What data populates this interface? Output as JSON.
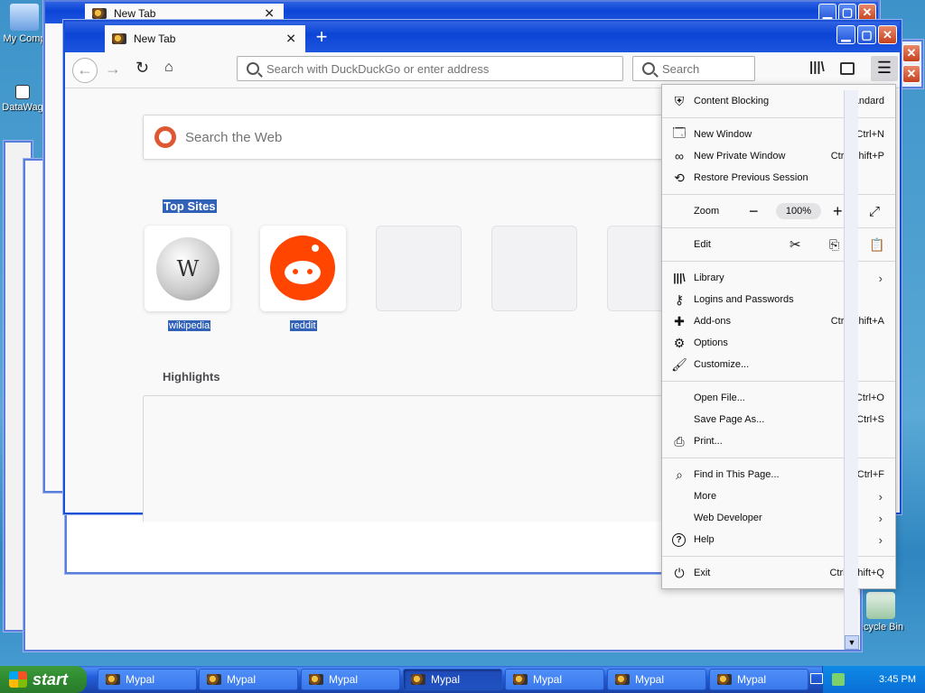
{
  "desktop": {
    "icons": [
      {
        "label": "My Comp"
      },
      {
        "label": "DataWag"
      },
      {
        "label": "ecycle Bin"
      }
    ]
  },
  "browser": {
    "back_window_tab": "New Tab",
    "tab_title": "New Tab",
    "new_tab_symbol": "+",
    "url_placeholder": "Search with DuckDuckGo or enter address",
    "search_placeholder": "Search",
    "page_search_placeholder": "Search the Web",
    "top_sites_heading": "Top Sites",
    "top_sites": [
      {
        "label": "wikipedia"
      },
      {
        "label": "reddit"
      }
    ],
    "highlights_heading": "Highlights"
  },
  "menu": {
    "content_blocking": {
      "label": "Content Blocking",
      "value": "Standard"
    },
    "new_window": {
      "label": "New Window",
      "shortcut": "Ctrl+N"
    },
    "new_private_window": {
      "label": "New Private Window",
      "shortcut": "Ctrl+Shift+P"
    },
    "restore_session": {
      "label": "Restore Previous Session"
    },
    "zoom": {
      "label": "Zoom",
      "value": "100%"
    },
    "edit": {
      "label": "Edit"
    },
    "library": {
      "label": "Library"
    },
    "logins": {
      "label": "Logins and Passwords"
    },
    "addons": {
      "label": "Add-ons",
      "shortcut": "Ctrl+Shift+A"
    },
    "options": {
      "label": "Options"
    },
    "customize": {
      "label": "Customize..."
    },
    "open_file": {
      "label": "Open File...",
      "shortcut": "Ctrl+O"
    },
    "save_page": {
      "label": "Save Page As...",
      "shortcut": "Ctrl+S"
    },
    "print": {
      "label": "Print..."
    },
    "find": {
      "label": "Find in This Page...",
      "shortcut": "Ctrl+F"
    },
    "more": {
      "label": "More"
    },
    "web_developer": {
      "label": "Web Developer"
    },
    "help": {
      "label": "Help"
    },
    "exit": {
      "label": "Exit",
      "shortcut": "Ctrl+Shift+Q"
    }
  },
  "taskbar": {
    "start_label": "start",
    "items": [
      {
        "label": "Mypal"
      },
      {
        "label": "Mypal"
      },
      {
        "label": "Mypal"
      },
      {
        "label": "Mypal"
      },
      {
        "label": "Mypal"
      },
      {
        "label": "Mypal"
      },
      {
        "label": "Mypal"
      }
    ],
    "clock": "3:45 PM"
  }
}
